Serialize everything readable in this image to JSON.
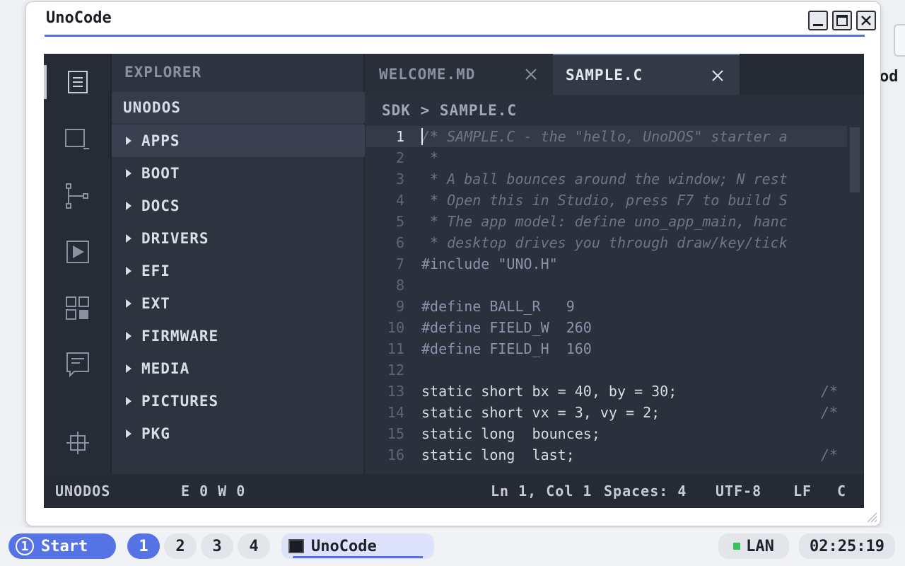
{
  "desktop": {
    "icon_label": "od"
  },
  "window": {
    "title": "UnoCode",
    "controls": {
      "minimize": "minimize-icon",
      "maximize": "maximize-icon",
      "close": "close-icon"
    }
  },
  "activity_bar": {
    "items": [
      "explorer-icon",
      "search-icon",
      "source-control-icon",
      "run-icon",
      "extensions-icon",
      "output-icon",
      "settings-icon"
    ]
  },
  "sidebar": {
    "title": "EXPLORER",
    "root": "UNODOS",
    "items": [
      {
        "label": "APPS"
      },
      {
        "label": "BOOT"
      },
      {
        "label": "DOCS"
      },
      {
        "label": "DRIVERS"
      },
      {
        "label": "EFI"
      },
      {
        "label": "EXT"
      },
      {
        "label": "FIRMWARE"
      },
      {
        "label": "MEDIA"
      },
      {
        "label": "PICTURES"
      },
      {
        "label": "PKG"
      }
    ]
  },
  "tabs": [
    {
      "label": "WELCOME.MD",
      "active": false
    },
    {
      "label": "SAMPLE.C",
      "active": true
    }
  ],
  "breadcrumb": {
    "part1": "SDK",
    "sep": ">",
    "part2": "SAMPLE.C"
  },
  "code": {
    "lines": [
      {
        "n": "1",
        "text": "/* SAMPLE.C - the \"hello, UnoDOS\" starter a"
      },
      {
        "n": "2",
        "text": " *"
      },
      {
        "n": "3",
        "text": " * A ball bounces around the window; N rest"
      },
      {
        "n": "4",
        "text": " * Open this in Studio, press F7 to build S"
      },
      {
        "n": "5",
        "text": " * The app model: define uno_app_main, hanc"
      },
      {
        "n": "6",
        "text": " * desktop drives you through draw/key/tick"
      },
      {
        "n": "7",
        "text": "#include \"UNO.H\""
      },
      {
        "n": "8",
        "text": ""
      },
      {
        "n": "9",
        "text": "#define BALL_R   9"
      },
      {
        "n": "10",
        "text": "#define FIELD_W  260"
      },
      {
        "n": "11",
        "text": "#define FIELD_H  160"
      },
      {
        "n": "12",
        "text": ""
      },
      {
        "n": "13",
        "text": "static short bx = 40, by = 30;",
        "trail": "/*"
      },
      {
        "n": "14",
        "text": "static short vx = 3, vy = 2;",
        "trail": "/*"
      },
      {
        "n": "15",
        "text": "static long  bounces;"
      },
      {
        "n": "16",
        "text": "static long  last;",
        "trail": "/*"
      }
    ]
  },
  "status_bar": {
    "project": "UNODOS",
    "problems": "E 0  W 0",
    "position": "Ln 1, Col 1",
    "spaces": "Spaces: 4",
    "encoding": "UTF-8",
    "eol": "LF",
    "language": "C"
  },
  "taskbar": {
    "start_num": "1",
    "start_label": "Start",
    "workspaces": [
      "1",
      "2",
      "3",
      "4"
    ],
    "active_workspace": "1",
    "task_label": "UnoCode",
    "network": "LAN",
    "clock": "02:25:19"
  }
}
